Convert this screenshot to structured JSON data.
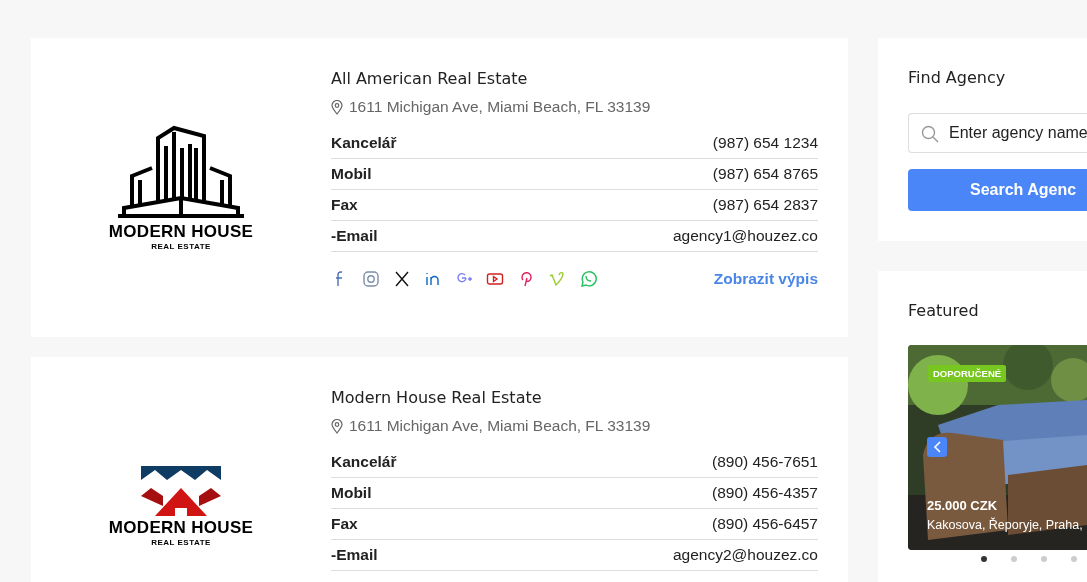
{
  "agencies": [
    {
      "name": "All American Real Estate",
      "address": "1611 Michigan Ave, Miami Beach, FL 33139",
      "logo": {
        "kind": "buildings",
        "name": "MODERN HOUSE",
        "tagline": "REAL ESTATE"
      },
      "contacts": [
        {
          "label": "Kancelář",
          "value": "(987) 654 1234"
        },
        {
          "label": "Mobil",
          "value": "(987) 654 8765"
        },
        {
          "label": "Fax",
          "value": "(987) 654 2837"
        },
        {
          "label": "-Email",
          "value": "agency1@houzez.co"
        }
      ],
      "socials": [
        {
          "kind": "facebook"
        },
        {
          "kind": "instagram"
        },
        {
          "kind": "x"
        },
        {
          "kind": "linkedin"
        },
        {
          "kind": "googleplus"
        },
        {
          "kind": "youtube"
        },
        {
          "kind": "pinterest"
        },
        {
          "kind": "vimeo"
        },
        {
          "kind": "whatsapp"
        }
      ],
      "link": "Zobrazit výpis"
    },
    {
      "name": "Modern House Real Estate",
      "address": "1611 Michigan Ave, Miami Beach, FL 33139",
      "logo": {
        "kind": "roofs",
        "name": "MODERN HOUSE",
        "tagline": "REAL ESTATE"
      },
      "contacts": [
        {
          "label": "Kancelář",
          "value": "(890) 456-7651"
        },
        {
          "label": "Mobil",
          "value": "(890) 456-4357"
        },
        {
          "label": "Fax",
          "value": "(890) 456-6457"
        },
        {
          "label": "-Email",
          "value": "agency2@houzez.co"
        }
      ]
    }
  ],
  "find_agency": {
    "title": "Find Agency",
    "search": {
      "placeholder": "Enter agency name"
    },
    "button": "Search Agenc"
  },
  "featured": {
    "title": "Featured",
    "listing": {
      "kind": "picture",
      "badge": "DOPORUČENÉ",
      "price": "25.000 CZK",
      "address": "Kakosova, Řeporyje, Praha,"
    },
    "dots": [
      {
        "selected": true
      },
      {
        "selected": false
      },
      {
        "selected": false
      },
      {
        "selected": false
      }
    ]
  }
}
